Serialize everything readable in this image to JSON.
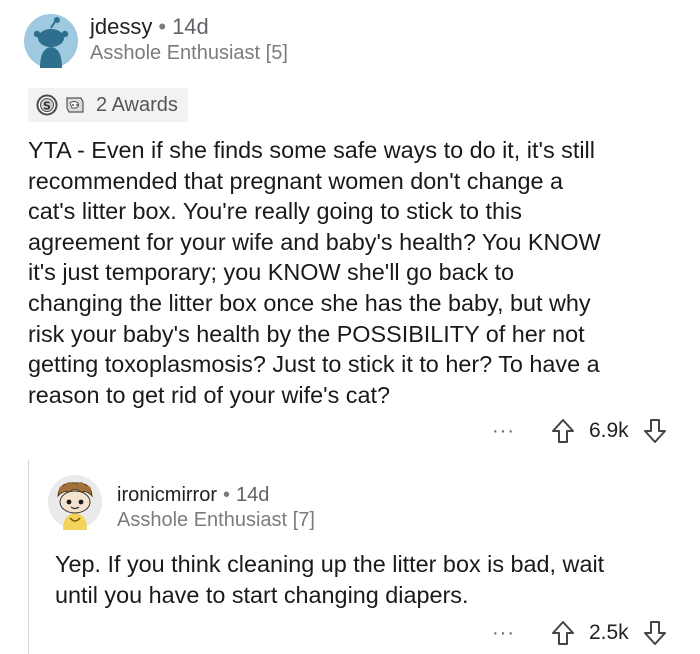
{
  "comments": [
    {
      "username": "jdessy",
      "time": "14d",
      "flair": "Asshole Enthusiast [5]",
      "awards_label": "2 Awards",
      "body": [
        "YTA - Even if she finds some safe ways to do it, it's still",
        "recommended that pregnant women don't change a",
        "cat's litter box. You're really going to stick to this",
        "agreement for your wife and baby's health? You KNOW",
        "it's just temporary; you KNOW she'll go back to",
        "changing the litter box once she has the baby, but why",
        "risk your baby's health by the POSSIBILITY of her not",
        "getting toxoplasmosis? Just to stick it to her? To have a",
        "reason to get rid of your wife's cat?"
      ],
      "score": "6.9k",
      "more": "···"
    },
    {
      "username": "ironicmirror",
      "time": "14d",
      "flair": "Asshole Enthusiast [7]",
      "body": [
        "Yep. If you think cleaning up the litter box is bad, wait",
        "until you have to start changing diapers."
      ],
      "score": "2.5k",
      "more": "···"
    }
  ],
  "separator": "•",
  "colors": {
    "avatar_bg": "#9fc9e0",
    "text": "#1a1a1b",
    "meta": "#7c7c7c",
    "award_bg": "#f2f2f2",
    "thread_line": "#d6d6d6"
  },
  "icons": [
    "reddit-snoo-avatar-icon",
    "silver-award-icon",
    "helpful-award-icon",
    "upvote-arrow-icon",
    "downvote-arrow-icon",
    "more-options-icon"
  ]
}
